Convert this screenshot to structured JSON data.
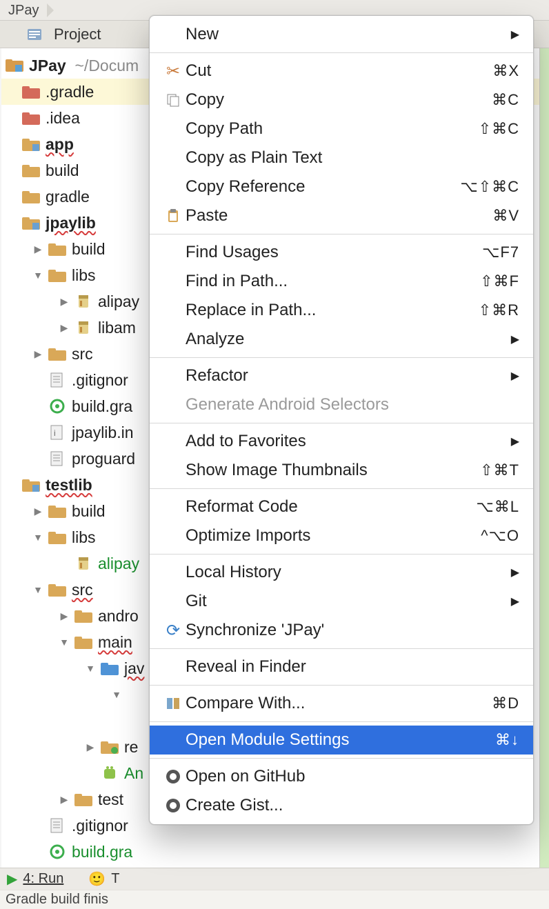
{
  "breadcrumb": {
    "items": [
      "JPay"
    ]
  },
  "panel": {
    "title": "Project"
  },
  "project": {
    "root_name": "JPay",
    "root_path": "~/Docum",
    "nodes": [
      {
        "depth": 0,
        "tri": "",
        "icon": "folder-red",
        "label": ".gradle",
        "style": "sel"
      },
      {
        "depth": 0,
        "tri": "",
        "icon": "folder-red",
        "label": ".idea"
      },
      {
        "depth": 0,
        "tri": "",
        "icon": "module",
        "label": "app",
        "bold": true,
        "wavy": true
      },
      {
        "depth": 0,
        "tri": "",
        "icon": "folder",
        "label": "build"
      },
      {
        "depth": 0,
        "tri": "",
        "icon": "folder",
        "label": "gradle"
      },
      {
        "depth": 0,
        "tri": "",
        "icon": "module",
        "label": "jpaylib",
        "bold": true,
        "wavy": true
      },
      {
        "depth": 1,
        "tri": "r",
        "icon": "folder",
        "label": "build"
      },
      {
        "depth": 1,
        "tri": "d",
        "icon": "folder",
        "label": "libs"
      },
      {
        "depth": 2,
        "tri": "r",
        "icon": "jar",
        "label": "alipay"
      },
      {
        "depth": 2,
        "tri": "r",
        "icon": "jar",
        "label": "libam"
      },
      {
        "depth": 1,
        "tri": "r",
        "icon": "folder",
        "label": "src"
      },
      {
        "depth": 1,
        "tri": "",
        "icon": "file",
        "label": ".gitignor"
      },
      {
        "depth": 1,
        "tri": "",
        "icon": "gradle",
        "label": "build.gra"
      },
      {
        "depth": 1,
        "tri": "",
        "icon": "file-x",
        "label": "jpaylib.in"
      },
      {
        "depth": 1,
        "tri": "",
        "icon": "file",
        "label": "proguard"
      },
      {
        "depth": 0,
        "tri": "",
        "icon": "module",
        "label": "testlib",
        "bold": true,
        "wavy": true
      },
      {
        "depth": 1,
        "tri": "r",
        "icon": "folder",
        "label": "build"
      },
      {
        "depth": 1,
        "tri": "d",
        "icon": "folder",
        "label": "libs"
      },
      {
        "depth": 2,
        "tri": "",
        "icon": "jar",
        "label": "alipay",
        "green": true
      },
      {
        "depth": 1,
        "tri": "d",
        "icon": "folder",
        "label": "src",
        "wavy": true
      },
      {
        "depth": 2,
        "tri": "r",
        "icon": "folder",
        "label": "andro"
      },
      {
        "depth": 2,
        "tri": "d",
        "icon": "folder",
        "label": "main",
        "wavy": true
      },
      {
        "depth": 3,
        "tri": "d",
        "icon": "folder-blue",
        "label": "jav",
        "wavy": true
      },
      {
        "depth": 4,
        "tri": "d",
        "icon": "",
        "label": ""
      },
      {
        "depth": 5,
        "tri": "",
        "icon": "",
        "label": ""
      },
      {
        "depth": 3,
        "tri": "r",
        "icon": "folder-res",
        "label": "re"
      },
      {
        "depth": 3,
        "tri": "",
        "icon": "android",
        "label": "An",
        "green": true
      },
      {
        "depth": 2,
        "tri": "r",
        "icon": "folder",
        "label": "test"
      },
      {
        "depth": 1,
        "tri": "",
        "icon": "file",
        "label": ".gitignor"
      },
      {
        "depth": 1,
        "tri": "",
        "icon": "gradle",
        "label": "build.gra",
        "green": true
      }
    ]
  },
  "menu": {
    "items": [
      {
        "icon": "",
        "text": "New",
        "sub": true
      },
      {
        "sep": true
      },
      {
        "icon": "cut",
        "text": "Cut",
        "key": "⌘X"
      },
      {
        "icon": "copy",
        "text": "Copy",
        "key": "⌘C"
      },
      {
        "icon": "",
        "text": "Copy Path",
        "key": "⇧⌘C"
      },
      {
        "icon": "",
        "text": "Copy as Plain Text",
        "key": ""
      },
      {
        "icon": "",
        "text": "Copy Reference",
        "key": "⌥⇧⌘C"
      },
      {
        "icon": "paste",
        "text": "Paste",
        "key": "⌘V"
      },
      {
        "sep": true
      },
      {
        "icon": "",
        "text": "Find Usages",
        "key": "⌥F7"
      },
      {
        "icon": "",
        "text": "Find in Path...",
        "key": "⇧⌘F"
      },
      {
        "icon": "",
        "text": "Replace in Path...",
        "key": "⇧⌘R"
      },
      {
        "icon": "",
        "text": "Analyze",
        "sub": true
      },
      {
        "sep": true
      },
      {
        "icon": "",
        "text": "Refactor",
        "sub": true
      },
      {
        "icon": "",
        "text": "Generate Android Selectors",
        "disabled": true
      },
      {
        "sep": true
      },
      {
        "icon": "",
        "text": "Add to Favorites",
        "sub": true
      },
      {
        "icon": "",
        "text": "Show Image Thumbnails",
        "key": "⇧⌘T"
      },
      {
        "sep": true
      },
      {
        "icon": "",
        "text": "Reformat Code",
        "key": "⌥⌘L"
      },
      {
        "icon": "",
        "text": "Optimize Imports",
        "key": "^⌥O"
      },
      {
        "sep": true
      },
      {
        "icon": "",
        "text": "Local History",
        "sub": true
      },
      {
        "icon": "",
        "text": "Git",
        "sub": true
      },
      {
        "icon": "sync",
        "text": "Synchronize 'JPay'",
        "key": ""
      },
      {
        "sep": true
      },
      {
        "icon": "",
        "text": "Reveal in Finder",
        "key": ""
      },
      {
        "sep": true
      },
      {
        "icon": "compare",
        "text": "Compare With...",
        "key": "⌘D"
      },
      {
        "sep": true
      },
      {
        "icon": "",
        "text": "Open Module Settings",
        "key": "⌘↓",
        "sel": true
      },
      {
        "sep": true
      },
      {
        "icon": "github",
        "text": "Open on GitHub",
        "key": ""
      },
      {
        "icon": "github",
        "text": "Create Gist...",
        "key": ""
      }
    ]
  },
  "status": {
    "run_label": "4: Run",
    "terminal_item": "T",
    "build_msg": "Gradle build finis"
  }
}
